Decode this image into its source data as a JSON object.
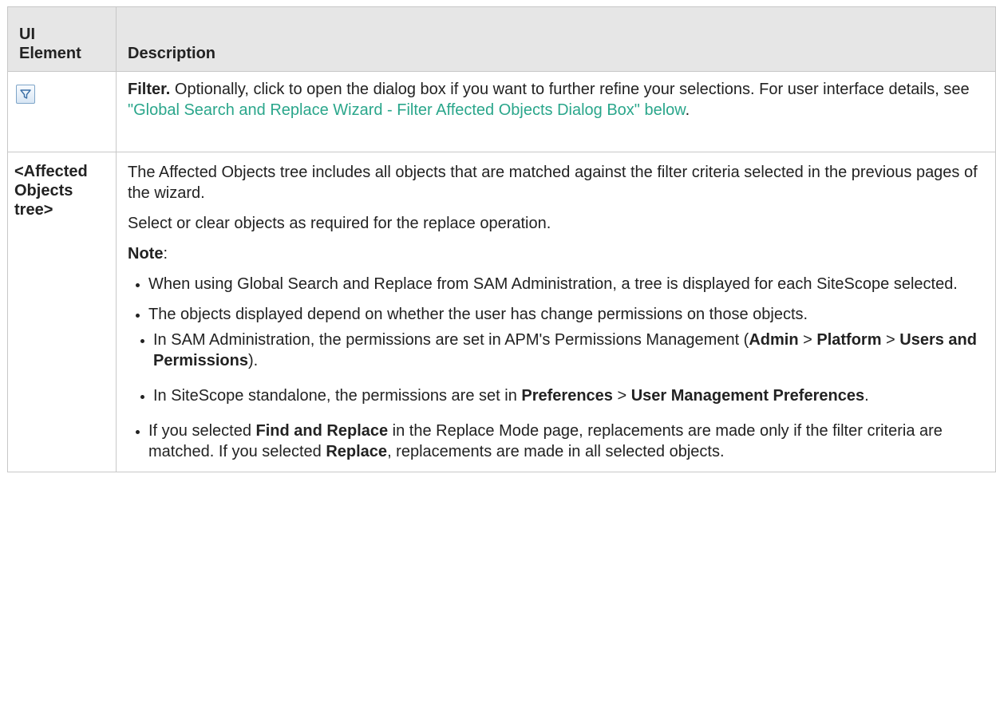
{
  "table": {
    "header": {
      "col1_line1": "UI",
      "col1_line2": "Element",
      "col2": "Description"
    },
    "filter_row": {
      "icon": "filter-icon",
      "lead": "Filter.",
      "text": " Optionally, click to open the dialog box if you want to further refine your selections. For user interface details, see ",
      "link": "\"Global Search and Replace Wizard - Filter Affected Objects Dialog Box\" below",
      "end": "."
    },
    "tree_row": {
      "ui_line1": "<Affected",
      "ui_line2": "Objects",
      "ui_line3": "tree>",
      "para1": "The Affected Objects tree includes all objects that are matched against the filter criteria selected in the previous pages of the wizard.",
      "para2": "Select or clear objects as required for the replace operation.",
      "note_label": "Note",
      "note_colon": ":",
      "bullet1": "When using Global Search and Replace from SAM Administration, a tree is displayed for each SiteScope selected.",
      "bullet2": "The objects displayed depend on whether the user has change permissions on those objects.",
      "sub1": {
        "text": "In SAM Administration, the permissions are set in APM's Permissions Management (",
        "b1": "Admin",
        "sep1": " > ",
        "b2": "Platform",
        "sep2": " > ",
        "b3": "Users and Permissions",
        "end": ")."
      },
      "sub2": {
        "text": "In SiteScope standalone, the permissions are set in ",
        "b1": "Preferences",
        "sep1": " > ",
        "b2": "User Management Preferences",
        "end": "."
      },
      "bullet3": {
        "t1": "If you selected ",
        "b1": "Find and Replace",
        "t2": " in the Replace Mode page, replacements are made only if the filter criteria are matched. If you selected ",
        "b2": "Replace",
        "t3": ", replacements are made in all selected objects."
      }
    }
  }
}
